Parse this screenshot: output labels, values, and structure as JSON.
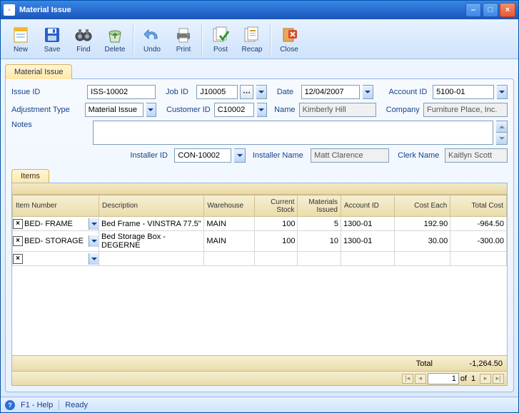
{
  "window": {
    "title": "Material Issue"
  },
  "winbuttons": {
    "min": "–",
    "max": "□",
    "close": "×"
  },
  "toolbar": {
    "new": "New",
    "save": "Save",
    "find": "Find",
    "delete": "Delete",
    "undo": "Undo",
    "print": "Print",
    "post": "Post",
    "recap": "Recap",
    "close": "Close"
  },
  "tabs": {
    "main": "Material Issue",
    "items": "Items"
  },
  "labels": {
    "issue_id": "Issue ID",
    "job_id": "Job ID",
    "date": "Date",
    "account_id": "Account ID",
    "adj_type": "Adjustment Type",
    "customer_id": "Customer ID",
    "name": "Name",
    "company": "Company",
    "notes": "Notes",
    "installer_id": "Installer ID",
    "installer_name": "Installer Name",
    "clerk_name": "Clerk Name"
  },
  "fields": {
    "issue_id": "ISS-10002",
    "job_id": "J10005",
    "date": "12/04/2007",
    "account_id": "5100-01",
    "adj_type": "Material Issue",
    "customer_id": "C10002",
    "name": "Kimberly Hill",
    "company": "Furniture Place, Inc.",
    "notes": "",
    "installer_id": "CON-10002",
    "installer_name": "Matt Clarence",
    "clerk_name": "Kaitlyn Scott"
  },
  "grid": {
    "headers": {
      "item_number": "Item Number",
      "description": "Description",
      "warehouse": "Warehouse",
      "current_stock": "Current Stock",
      "materials_issued": "Materials Issued",
      "account_id": "Account ID",
      "cost_each": "Cost Each",
      "total_cost": "Total Cost"
    },
    "rows": [
      {
        "item": "BED- FRAME",
        "desc": "Bed Frame - VINSTRA 77.5\"",
        "wh": "MAIN",
        "stock": "100",
        "issued": "5",
        "acct": "1300-01",
        "cost": "192.90",
        "total": "-964.50"
      },
      {
        "item": "BED- STORAGE",
        "desc": "Bed Storage Box - DEGERNE",
        "wh": "MAIN",
        "stock": "100",
        "issued": "10",
        "acct": "1300-01",
        "cost": "30.00",
        "total": "-300.00"
      },
      {
        "item": "",
        "desc": "",
        "wh": "",
        "stock": "",
        "issued": "",
        "acct": "",
        "cost": "",
        "total": ""
      }
    ],
    "total_label": "Total",
    "total_value": "-1,264.50"
  },
  "pager": {
    "page": "1",
    "of_label": "of",
    "pages": "1"
  },
  "status": {
    "help": "F1 - Help",
    "ready": "Ready"
  }
}
